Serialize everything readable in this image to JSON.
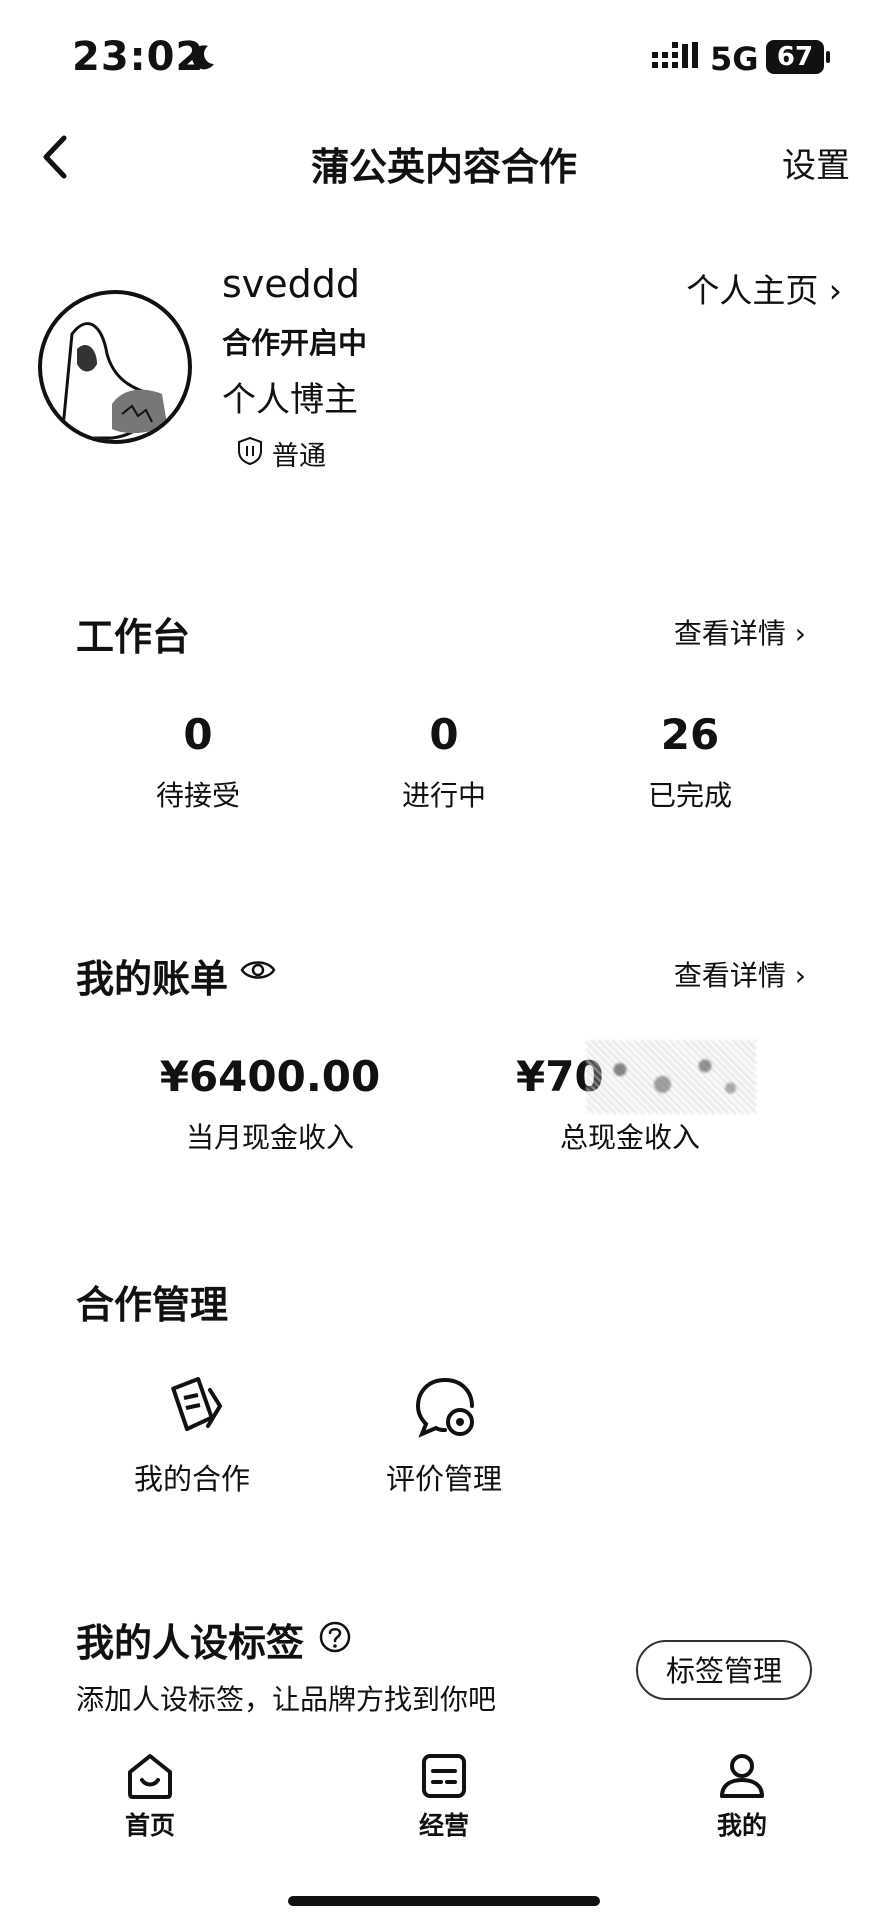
{
  "status_bar": {
    "time": "23:02",
    "network": "5G",
    "battery": "67"
  },
  "nav": {
    "title": "蒲公英内容合作",
    "settings_label": "设置"
  },
  "profile": {
    "username": "sveddd",
    "status": "合作开启中",
    "type": "个人博主",
    "level": "普通",
    "homepage_link": "个人主页 ›"
  },
  "workbench": {
    "title": "工作台",
    "detail_link": "查看详情 ›",
    "stats": [
      {
        "value": "0",
        "label": "待接受"
      },
      {
        "value": "0",
        "label": "进行中"
      },
      {
        "value": "26",
        "label": "已完成"
      }
    ]
  },
  "bill": {
    "title": "我的账单",
    "detail_link": "查看详情 ›",
    "monthly_value": "¥6400.00",
    "monthly_label": "当月现金收入",
    "total_value": "¥70",
    "total_label": "总现金收入"
  },
  "cooperation": {
    "title": "合作管理",
    "items": [
      {
        "label": "我的合作",
        "icon": "cooperation-icon"
      },
      {
        "label": "评价管理",
        "icon": "review-icon"
      }
    ]
  },
  "tags": {
    "title": "我的人设标签",
    "subtitle": "添加人设标签，让品牌方找到你吧",
    "manage_button": "标签管理"
  },
  "tabbar": {
    "items": [
      {
        "label": "首页",
        "icon": "home-icon"
      },
      {
        "label": "经营",
        "icon": "business-icon"
      },
      {
        "label": "我的",
        "icon": "profile-icon"
      }
    ]
  }
}
